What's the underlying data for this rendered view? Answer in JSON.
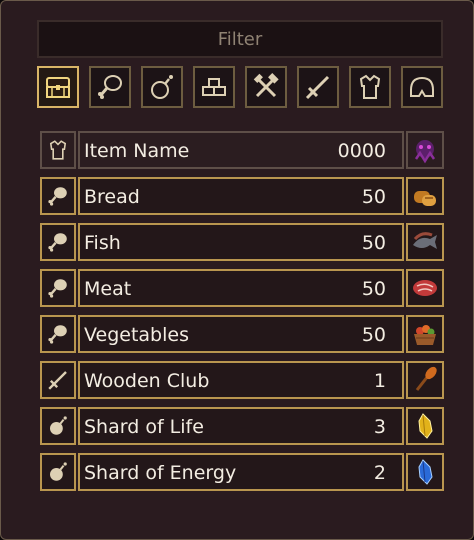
{
  "filter": {
    "placeholder": "Filter"
  },
  "tabs": [
    {
      "icon": "chest-icon",
      "active": true
    },
    {
      "icon": "drumstick-icon",
      "active": false
    },
    {
      "icon": "bomb-potion-icon",
      "active": false
    },
    {
      "icon": "bricks-icon",
      "active": false
    },
    {
      "icon": "crossed-tools-icon",
      "active": false
    },
    {
      "icon": "sword-icon",
      "active": false
    },
    {
      "icon": "armor-icon",
      "active": false
    },
    {
      "icon": "helmet-icon",
      "active": false
    }
  ],
  "header": {
    "name": "Item Name",
    "qty": "0000",
    "icon": "armor-icon",
    "image": "purple-creature-icon"
  },
  "items": [
    {
      "name": "Bread",
      "qty": "50",
      "icon": "drumstick-icon",
      "image": "bread-icon"
    },
    {
      "name": "Fish",
      "qty": "50",
      "icon": "drumstick-icon",
      "image": "fish-icon"
    },
    {
      "name": "Meat",
      "qty": "50",
      "icon": "drumstick-icon",
      "image": "meat-icon"
    },
    {
      "name": "Vegetables",
      "qty": "50",
      "icon": "drumstick-icon",
      "image": "vegetable-basket-icon"
    },
    {
      "name": "Wooden Club",
      "qty": "1",
      "icon": "sword-icon",
      "image": "club-icon"
    },
    {
      "name": "Shard of Life",
      "qty": "3",
      "icon": "bomb-potion-icon",
      "image": "yellow-shard-icon"
    },
    {
      "name": "Shard of Energy",
      "qty": "2",
      "icon": "bomb-potion-icon",
      "image": "blue-shard-icon"
    }
  ],
  "colors": {
    "gold_border": "#b9964f",
    "active_tab": "#d9b567",
    "text": "#f3ede2",
    "panel": "#2a1b1f"
  }
}
